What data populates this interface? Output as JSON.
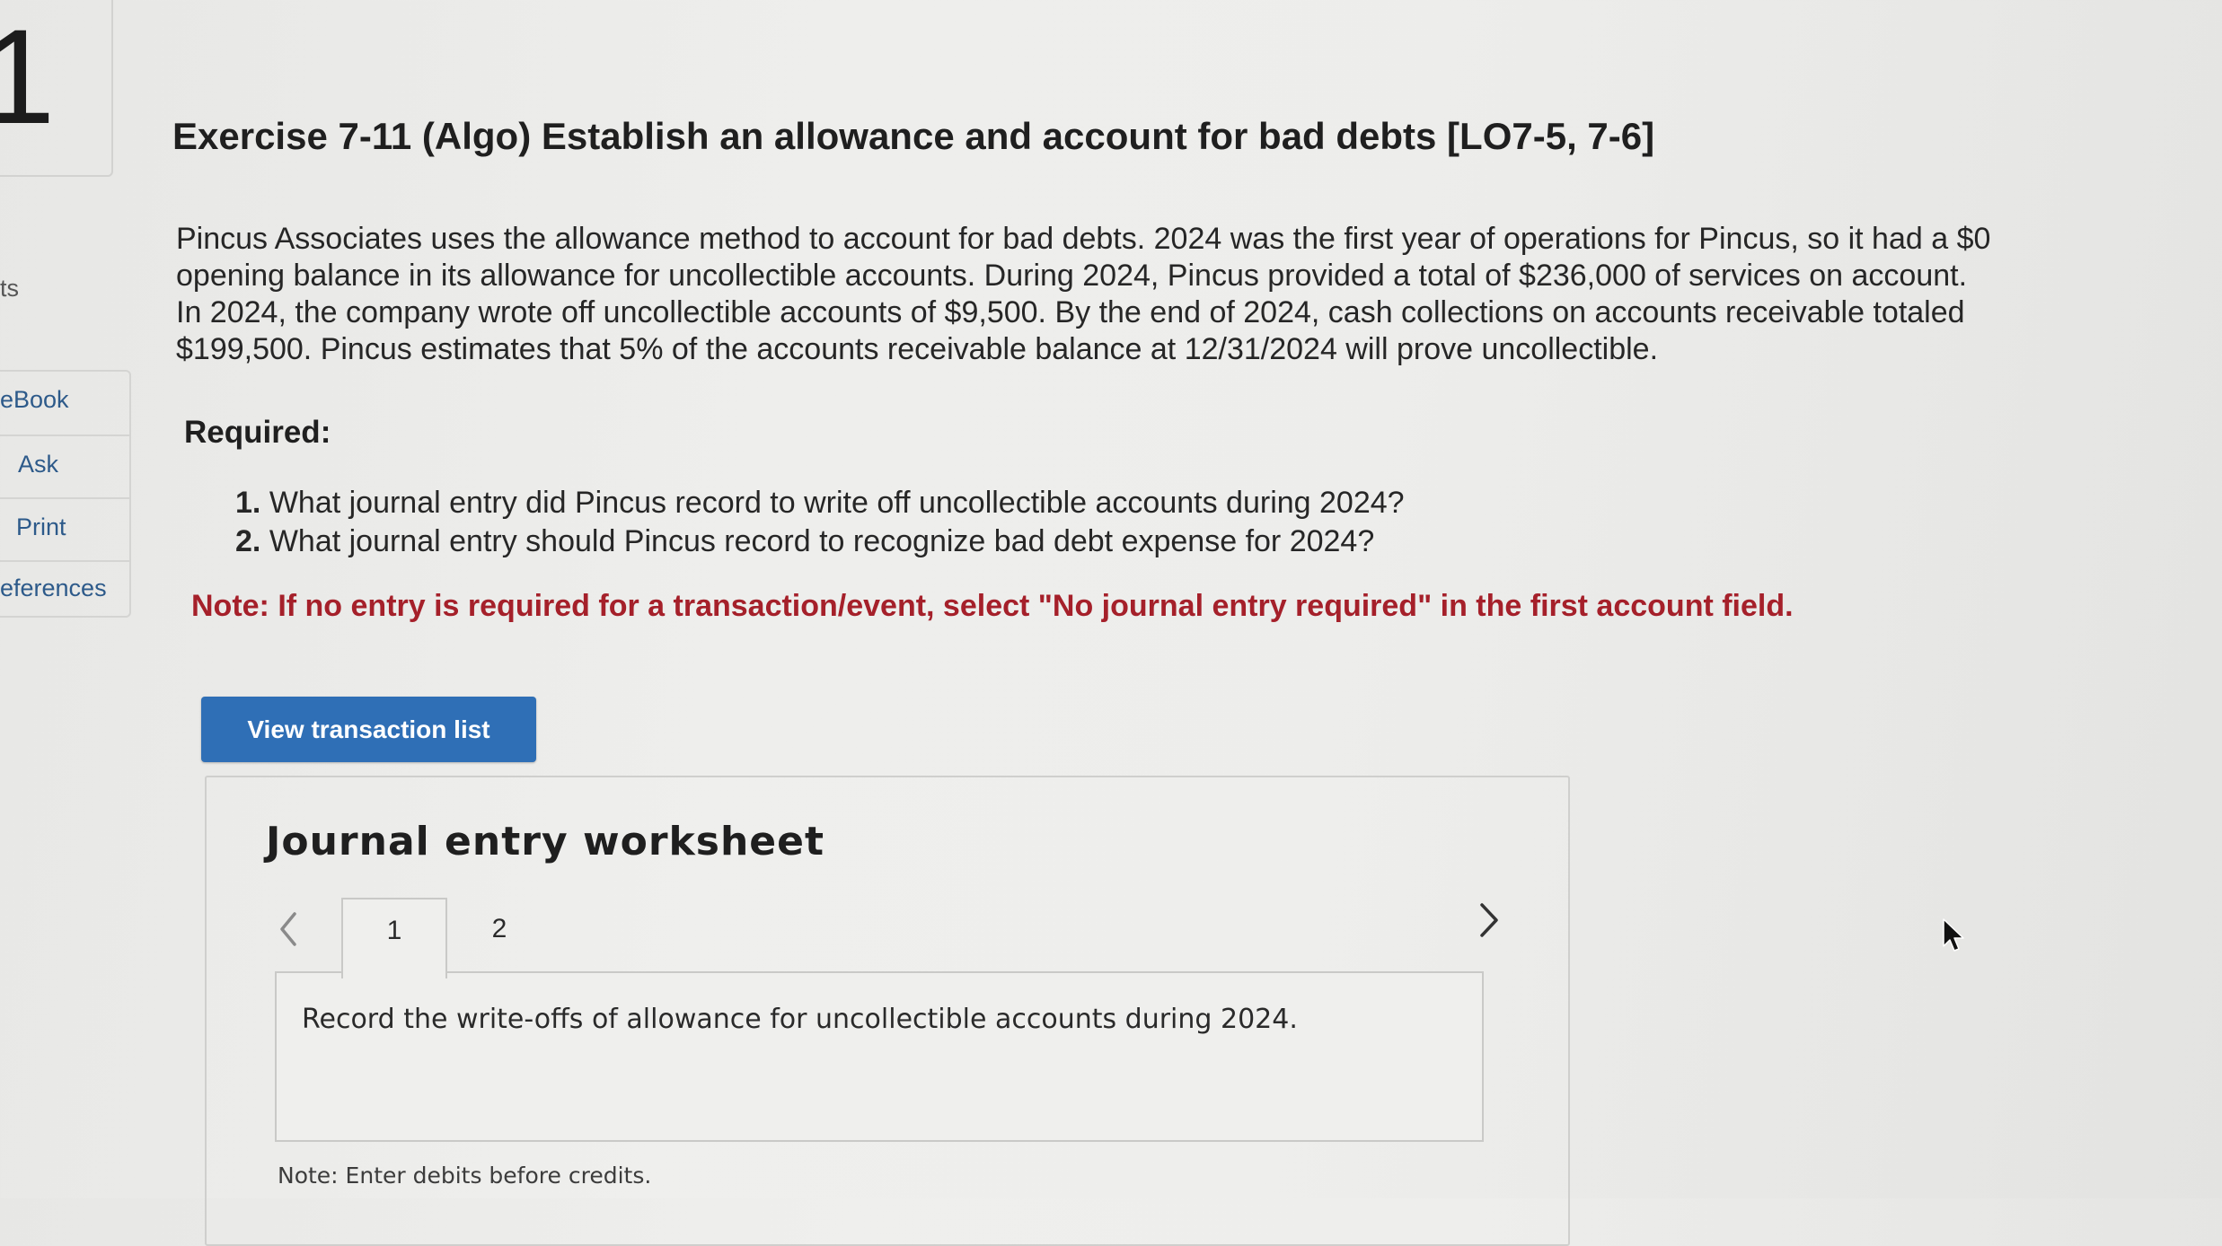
{
  "question_number": "1",
  "rail": {
    "partial_label": "ts",
    "items": [
      "eBook",
      "Ask",
      "Print",
      "eferences"
    ]
  },
  "exercise": {
    "title": "Exercise 7-11 (Algo) Establish an allowance and account for bad debts [LO7-5, 7-6]",
    "problem_lines": [
      "Pincus Associates uses the allowance method to account for bad debts. 2024 was the first year of operations for Pincus, so it had a $0",
      "opening balance in its allowance for uncollectible accounts. During 2024, Pincus provided a total of $236,000 of services on account.",
      "In 2024, the company wrote off uncollectible accounts of $9,500. By the end of 2024, cash collections on accounts receivable totaled",
      "$199,500. Pincus estimates that 5% of the accounts receivable balance at 12/31/2024 will prove uncollectible."
    ],
    "required_label": "Required:",
    "requirements": [
      {
        "num": "1.",
        "text": "What journal entry did Pincus record to write off uncollectible accounts during 2024?"
      },
      {
        "num": "2.",
        "text": "What journal entry should Pincus record to recognize bad debt expense for 2024?"
      }
    ],
    "note": "Note: If no entry is required for a transaction/event, select \"No journal entry required\" in the first account field."
  },
  "button": {
    "view_transactions_label": "View transaction list"
  },
  "worksheet": {
    "title": "Journal entry worksheet",
    "tabs": [
      "1",
      "2"
    ],
    "active_tab": "1",
    "instruction": "Record the write-offs of allowance for uncollectible accounts during 2024.",
    "note": "Note: Enter debits before credits."
  },
  "colors": {
    "button_blue": "#2f6fb6",
    "note_red": "#a5202a",
    "link_blue": "#2d5a8a"
  }
}
